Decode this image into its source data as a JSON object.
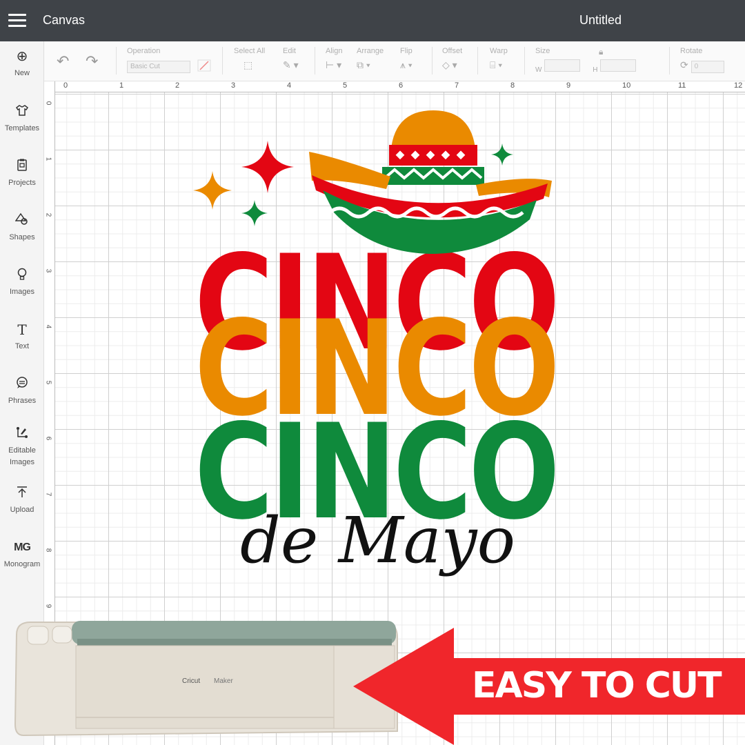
{
  "topbar": {
    "app_title": "Canvas",
    "doc_title": "Untitled"
  },
  "sidebar": {
    "items": [
      {
        "label": "New",
        "icon": "plus-circle-icon"
      },
      {
        "label": "Templates",
        "icon": "shirt-icon"
      },
      {
        "label": "Projects",
        "icon": "clipboard-icon"
      },
      {
        "label": "Shapes",
        "icon": "shapes-icon"
      },
      {
        "label": "Images",
        "icon": "lightbulb-icon"
      },
      {
        "label": "Text",
        "icon": "text-icon"
      },
      {
        "label": "Phrases",
        "icon": "speech-bubble-icon"
      },
      {
        "label": "Editable Images",
        "icon": "editable-image-icon"
      },
      {
        "label": "Upload",
        "icon": "upload-icon"
      },
      {
        "label": "Monogram",
        "icon": "monogram-icon"
      }
    ]
  },
  "toolbar": {
    "operation_label": "Operation",
    "operation_value": "Basic Cut",
    "select_all_label": "Select All",
    "edit_label": "Edit",
    "align_label": "Align",
    "arrange_label": "Arrange",
    "flip_label": "Flip",
    "offset_label": "Offset",
    "warp_label": "Warp",
    "size_label": "Size",
    "w_label": "W",
    "h_label": "H",
    "rotate_label": "Rotate",
    "rotate_value": "0"
  },
  "ruler": {
    "top": [
      "0",
      "1",
      "2",
      "3",
      "4",
      "5",
      "6",
      "7",
      "8",
      "9",
      "10",
      "11",
      "12"
    ],
    "left": [
      "0",
      "1",
      "2",
      "3",
      "4",
      "5",
      "6",
      "7",
      "8",
      "9"
    ]
  },
  "design": {
    "word_1": "CINCO",
    "word_2": "CINCO",
    "word_3": "CINCO",
    "script_text": "de Mayo",
    "colors": {
      "red": "#e30613",
      "orange": "#ea8a00",
      "green": "#0f8a3c"
    }
  },
  "machine": {
    "brand": "Cricut",
    "model": "Maker"
  },
  "banner": {
    "text": "EASY TO CUT",
    "color": "#f0262b"
  }
}
